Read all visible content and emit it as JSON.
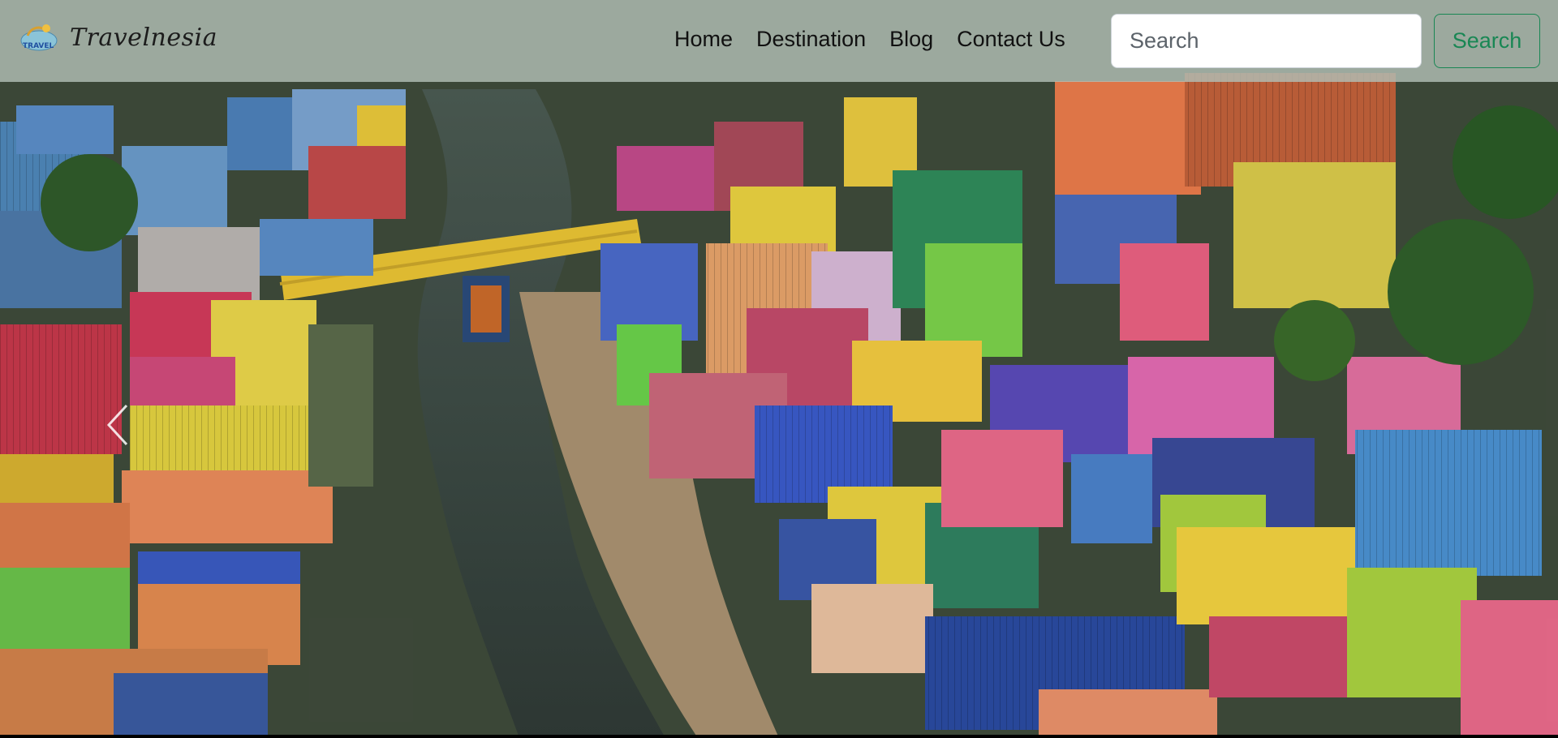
{
  "brand": {
    "logo_text": "TRAVEL",
    "name": "Travelnesia"
  },
  "nav": {
    "links": [
      "Home",
      "Destination",
      "Blog",
      "Contact Us"
    ]
  },
  "search": {
    "placeholder": "Search",
    "button_label": "Search"
  },
  "hero": {
    "image": "aerial view of colorful village rooftops along a river with a yellow bridge",
    "carousel": {
      "prev_icon": "chevron-left-icon"
    }
  },
  "colors": {
    "navbar_bg": "#b2beb4",
    "search_button": "#198754",
    "brand_text": "#1c1c1c",
    "nav_text": "#111111"
  }
}
